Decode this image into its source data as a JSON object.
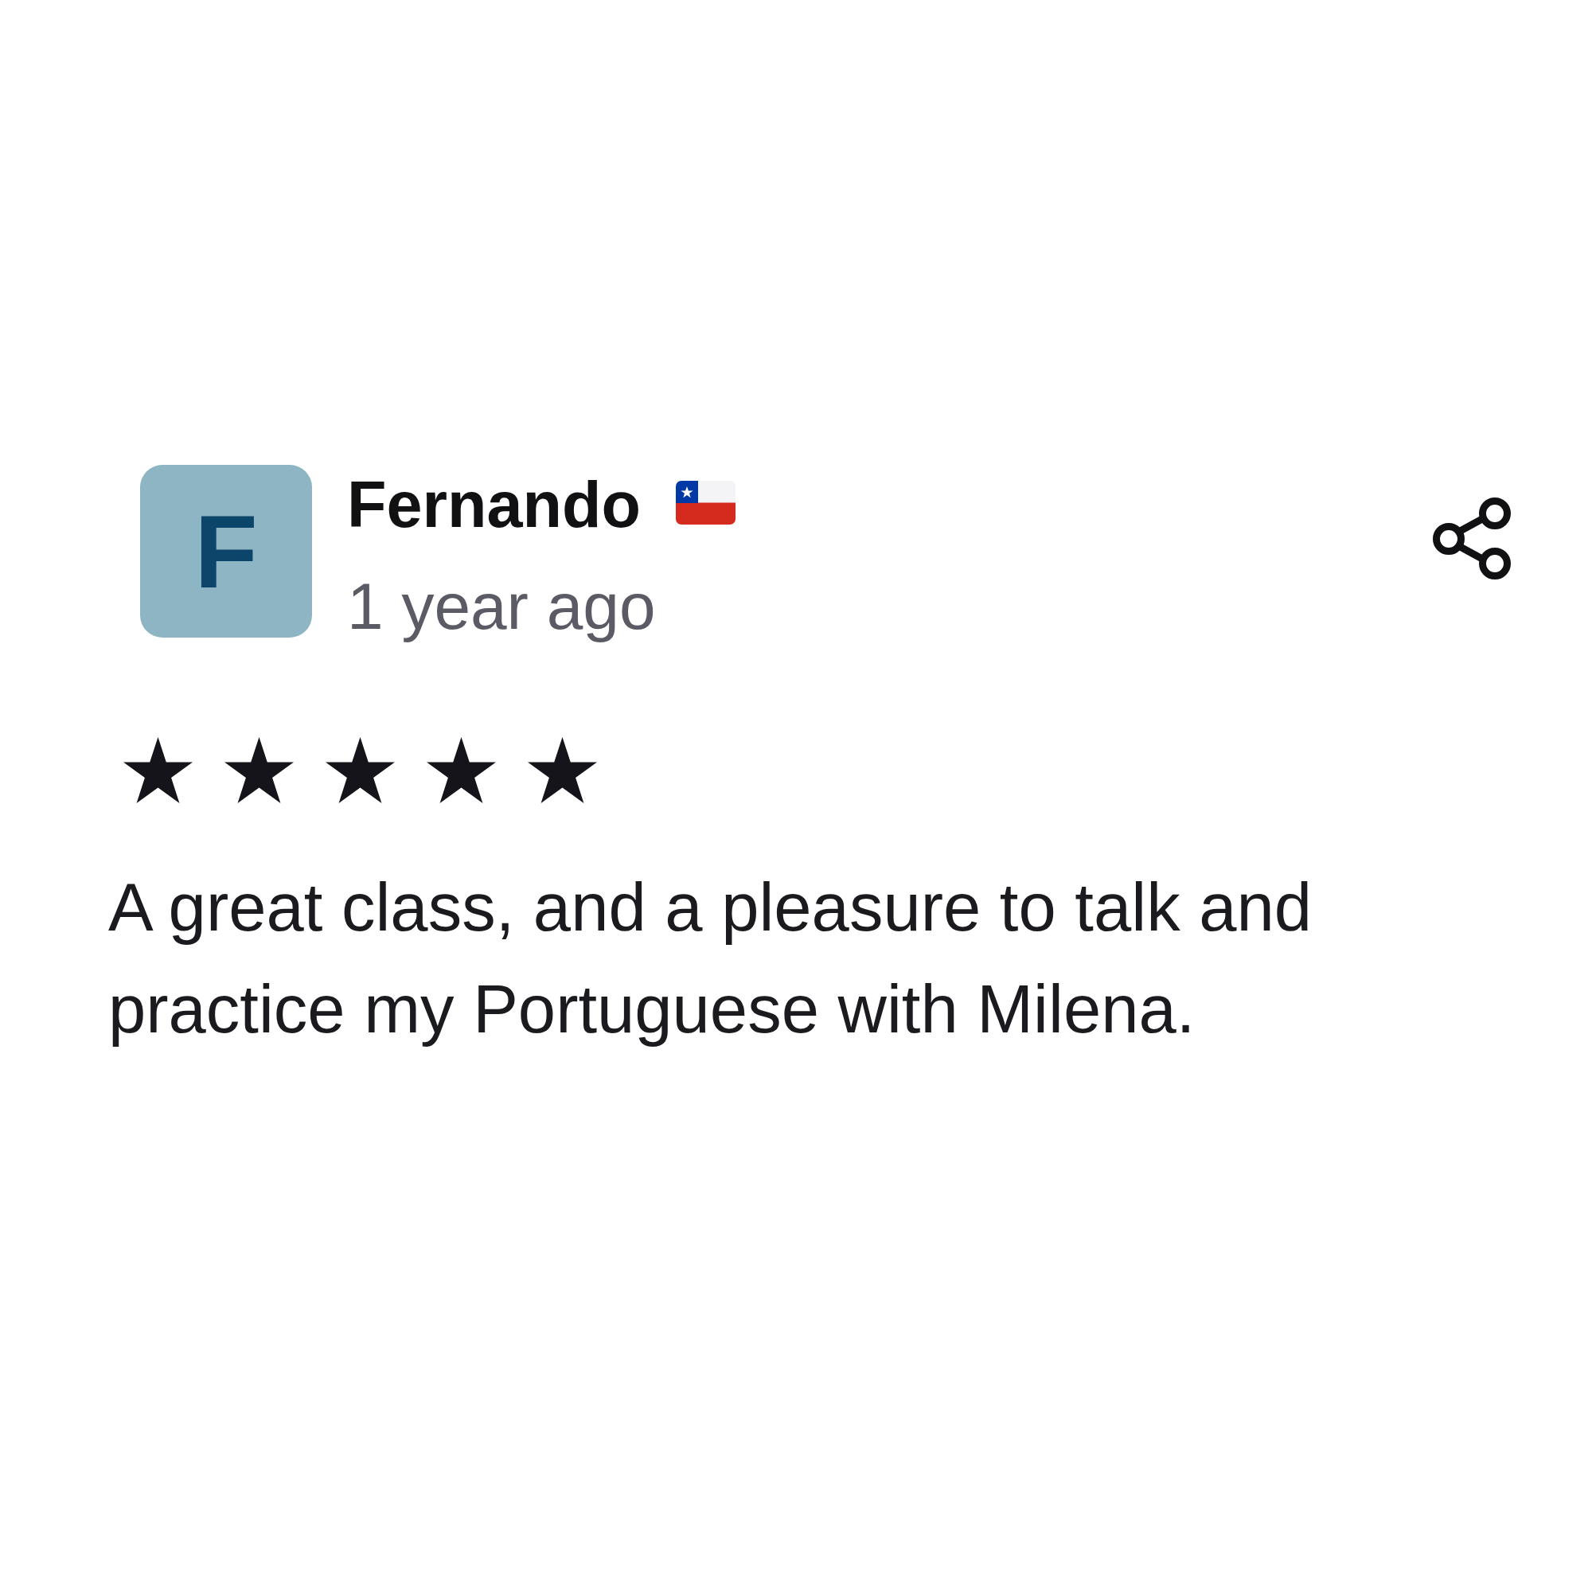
{
  "review": {
    "avatar_initial": "F",
    "name": "Fernando",
    "time": "1 year ago",
    "stars": 5,
    "text": "A great class, and a pleasure to talk and practice my Portuguese with Milena."
  }
}
